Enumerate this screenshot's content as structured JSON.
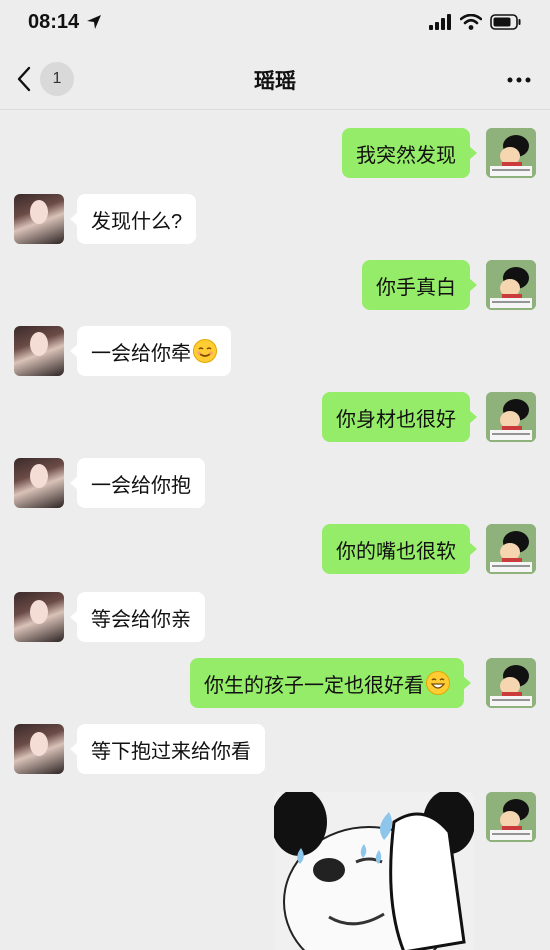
{
  "status": {
    "time": "08:14",
    "location_icon": "location-arrow-icon",
    "signal_icon": "signal-icon",
    "wifi_icon": "wifi-icon",
    "battery_icon": "battery-icon"
  },
  "nav": {
    "back_icon": "chevron-left-icon",
    "unread_count": "1",
    "title": "瑶瑶",
    "more_icon": "more-dots-icon"
  },
  "messages": [
    {
      "from": "me",
      "text": "我突然发现"
    },
    {
      "from": "them",
      "text": "发现什么?"
    },
    {
      "from": "me",
      "text": "你手真白"
    },
    {
      "from": "them",
      "text": "一会给你牵",
      "emoji": "smiling-face-icon"
    },
    {
      "from": "me",
      "text": "你身材也很好"
    },
    {
      "from": "them",
      "text": "一会给你抱"
    },
    {
      "from": "me",
      "text": "你的嘴也很软"
    },
    {
      "from": "them",
      "text": "等会给你亲"
    },
    {
      "from": "me",
      "text": "你生的孩子一定也很好看",
      "emoji": "grinning-face-icon"
    },
    {
      "from": "them",
      "text": "等下抱过来给你看"
    },
    {
      "from": "me",
      "type": "image",
      "sticker": "panda-meme-sticker-icon"
    }
  ],
  "colors": {
    "background": "#ededed",
    "my_bubble": "#95ec69",
    "their_bubble": "#ffffff"
  }
}
